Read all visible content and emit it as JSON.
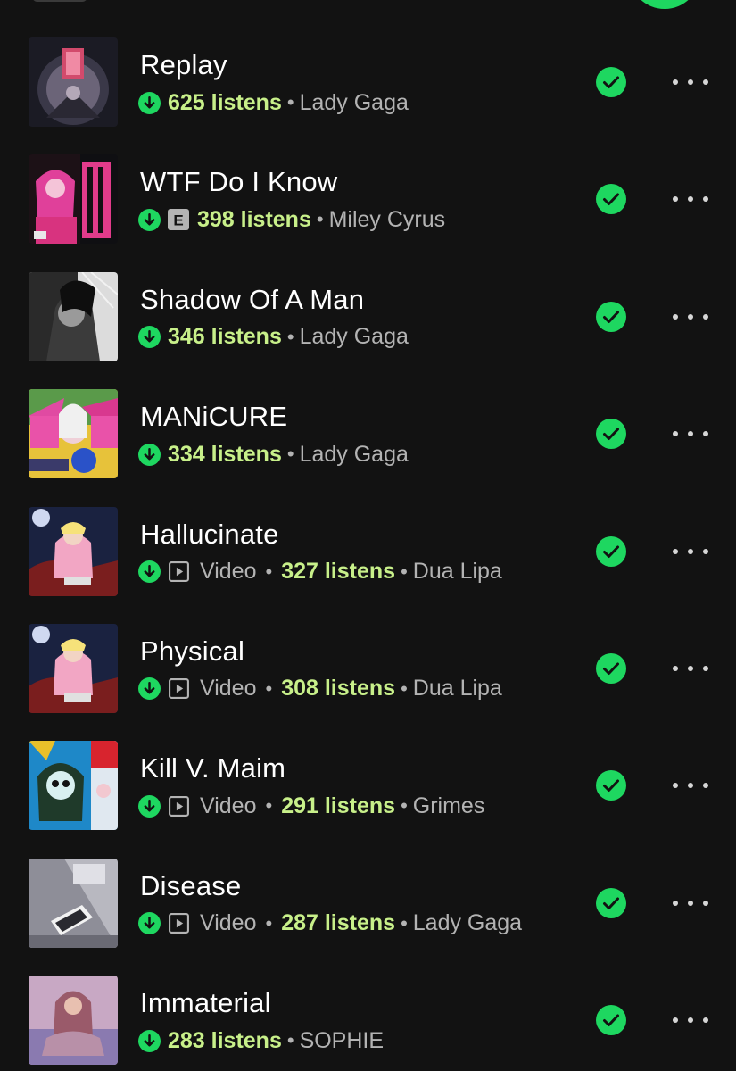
{
  "colors": {
    "background": "#121212",
    "accent_green": "#1ed760",
    "listens_green": "#c8f08a",
    "secondary_text": "#b3b3b3"
  },
  "icons": {
    "downloaded": "arrow-down-circle-icon",
    "explicit": "explicit-badge-icon",
    "video": "play-square-icon",
    "added": "check-circle-icon",
    "more": "more-options-icon"
  },
  "tracks": [
    {
      "title": "Replay",
      "explicit": false,
      "video": false,
      "listens": "625 listens",
      "artist": "Lady Gaga"
    },
    {
      "title": "WTF Do I Know",
      "explicit": true,
      "explicit_label": "E",
      "video": false,
      "listens": "398 listens",
      "artist": "Miley Cyrus"
    },
    {
      "title": "Shadow Of A Man",
      "explicit": false,
      "video": false,
      "listens": "346 listens",
      "artist": "Lady Gaga"
    },
    {
      "title": "MANiCURE",
      "explicit": false,
      "video": false,
      "listens": "334 listens",
      "artist": "Lady Gaga"
    },
    {
      "title": "Hallucinate",
      "explicit": false,
      "video": true,
      "video_label": "Video",
      "listens": "327 listens",
      "artist": "Dua Lipa"
    },
    {
      "title": "Physical",
      "explicit": false,
      "video": true,
      "video_label": "Video",
      "listens": "308 listens",
      "artist": "Dua Lipa"
    },
    {
      "title": "Kill V. Maim",
      "explicit": false,
      "video": true,
      "video_label": "Video",
      "listens": "291 listens",
      "artist": "Grimes"
    },
    {
      "title": "Disease",
      "explicit": false,
      "video": true,
      "video_label": "Video",
      "listens": "287 listens",
      "artist": "Lady Gaga"
    },
    {
      "title": "Immaterial",
      "explicit": false,
      "video": false,
      "listens": "283 listens",
      "artist": "SOPHIE"
    }
  ]
}
